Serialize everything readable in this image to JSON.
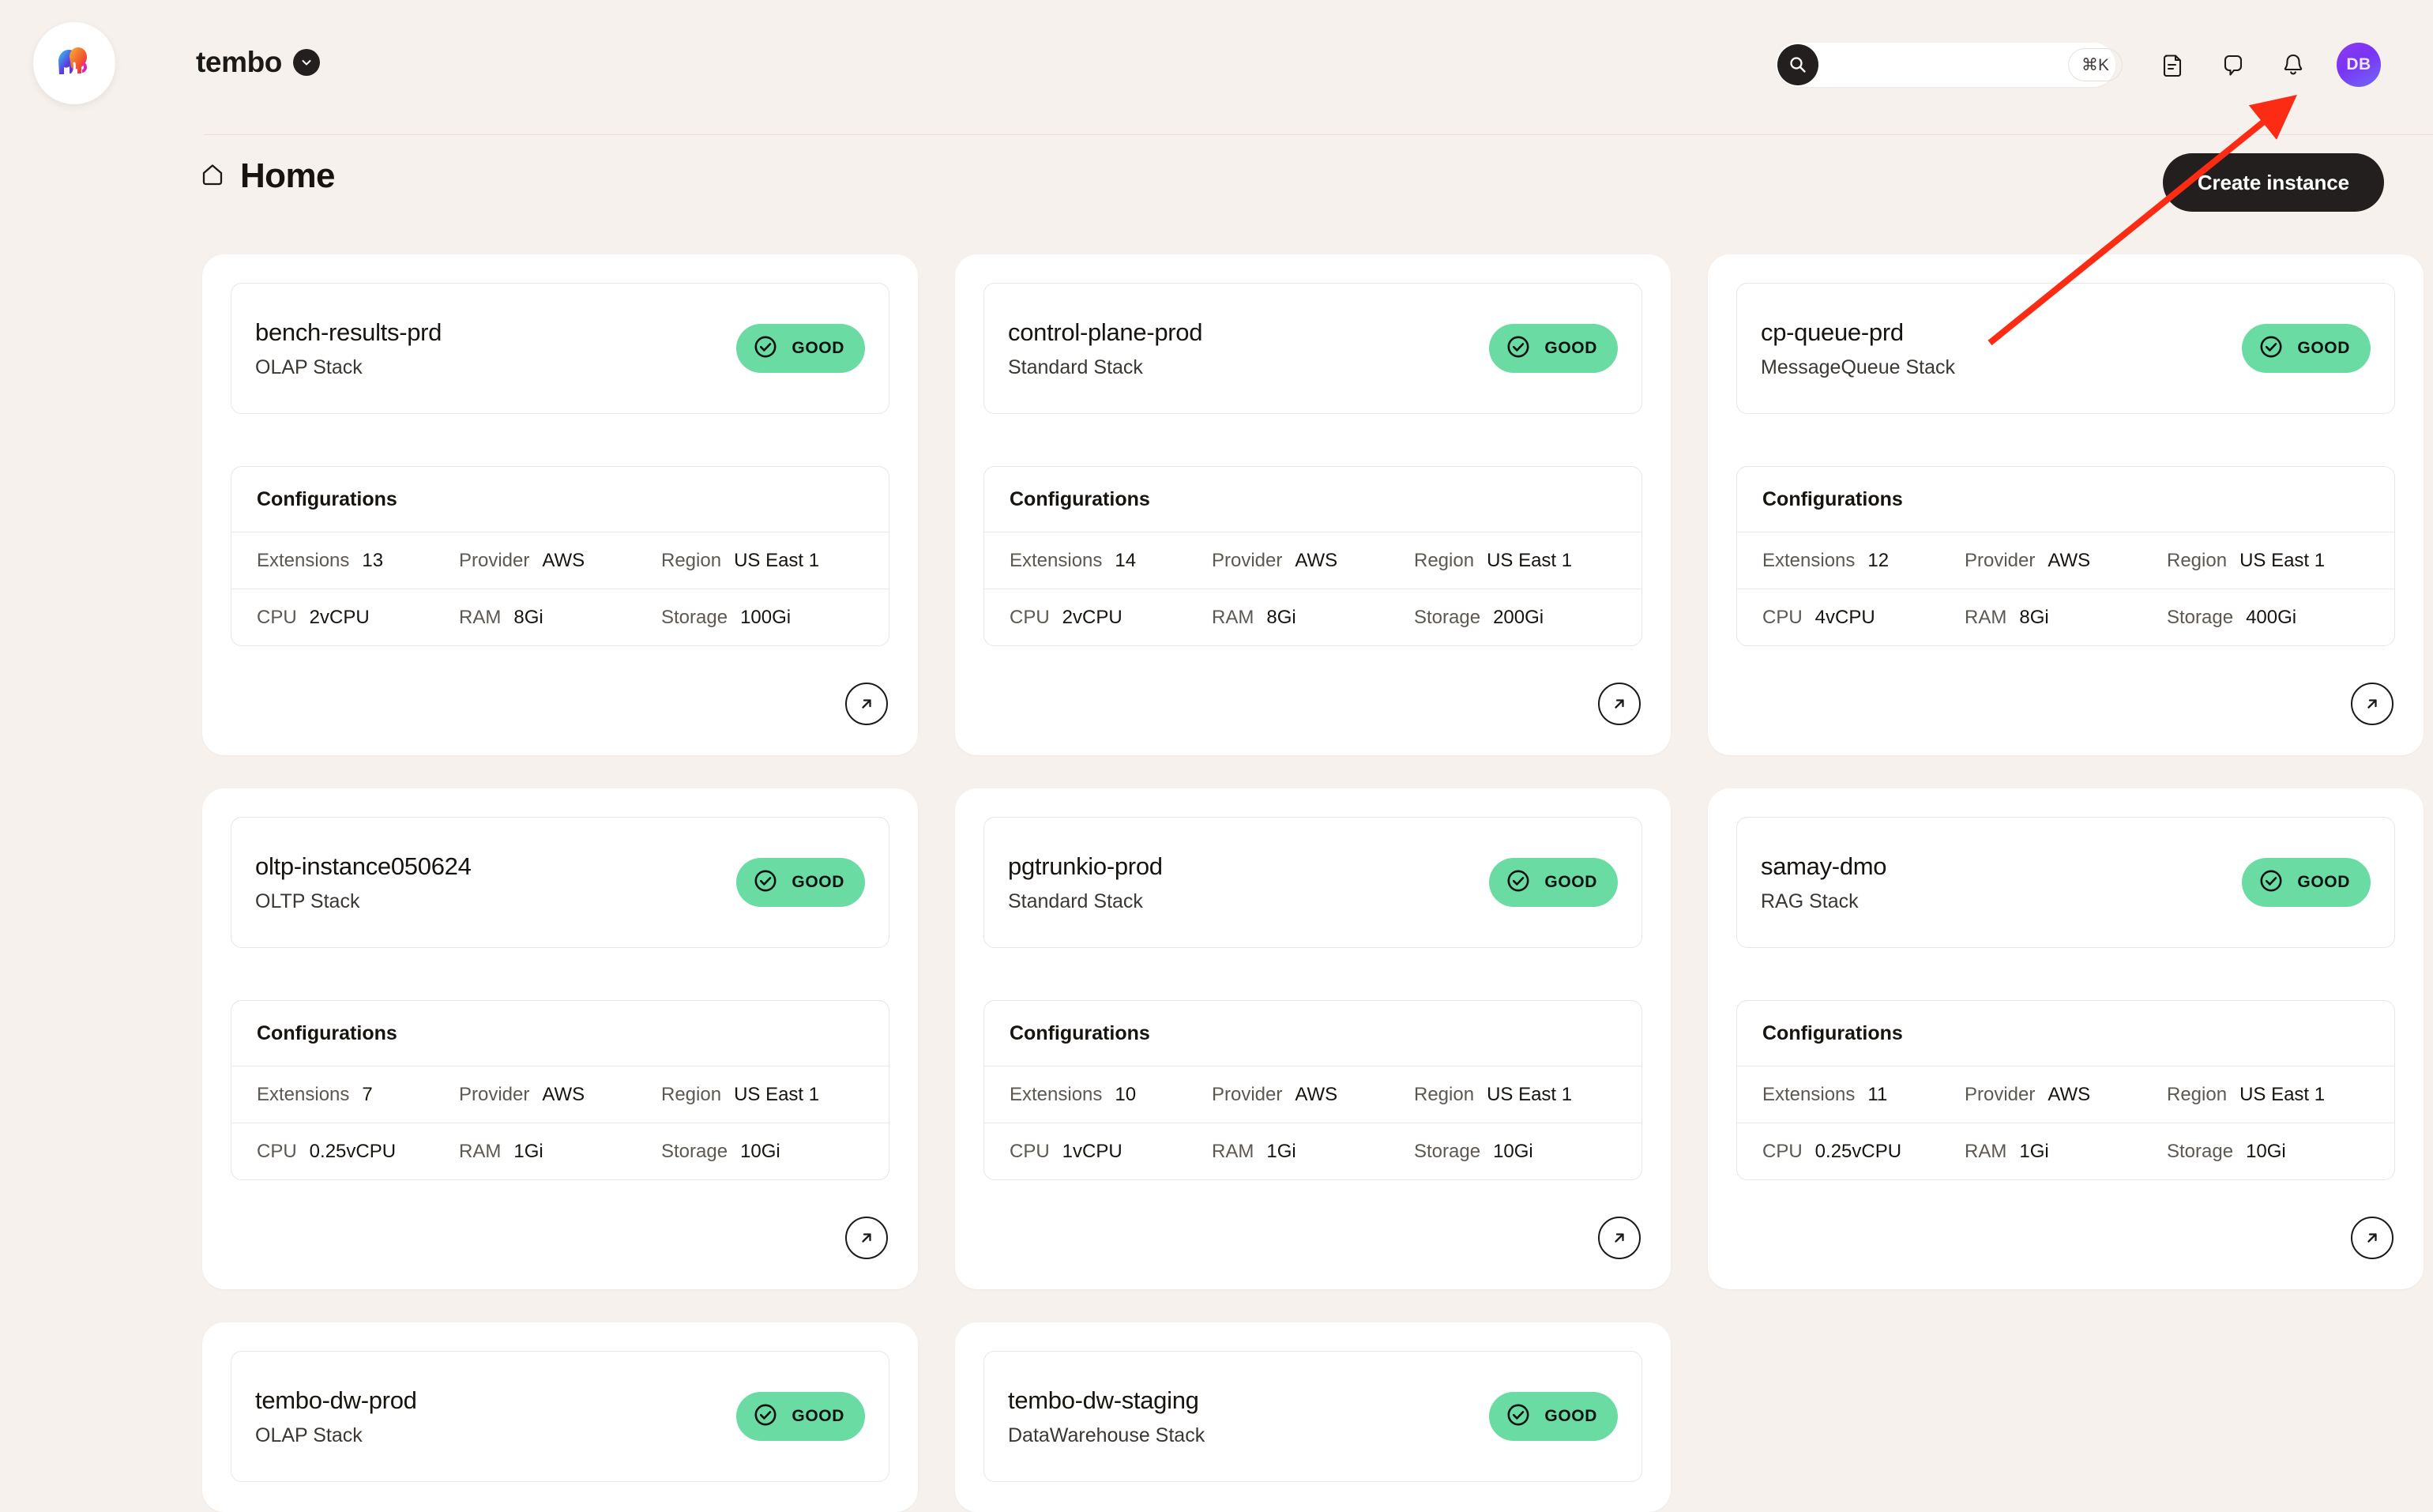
{
  "header": {
    "logo_icon": "tembo-elephant-logo",
    "org_name": "tembo",
    "org_chevron_icon": "chevron-down-icon",
    "search": {
      "icon": "search-icon",
      "value": "",
      "placeholder": "",
      "shortcut": "⌘K"
    },
    "icons": [
      {
        "name": "docs-icon"
      },
      {
        "name": "chat-bubble-icon"
      },
      {
        "name": "bell-icon"
      }
    ],
    "avatar": {
      "initials": "DB",
      "color": "#7A34F5"
    }
  },
  "page": {
    "home_icon": "home-icon",
    "title": "Home",
    "create_button": "Create instance"
  },
  "config_labels": {
    "panel_title": "Configurations",
    "extensions": "Extensions",
    "provider": "Provider",
    "region": "Region",
    "cpu": "CPU",
    "ram": "RAM",
    "storage": "Storage"
  },
  "status": {
    "label": "GOOD",
    "icon": "check-circle-icon",
    "color": "#6ADCA3"
  },
  "open_icon": "arrow-up-right-circle-icon",
  "instances": [
    {
      "name": "bench-results-prd",
      "stack": "OLAP Stack",
      "status": "GOOD",
      "extensions": "13",
      "provider": "AWS",
      "region": "US East 1",
      "cpu": "2vCPU",
      "ram": "8Gi",
      "storage": "100Gi",
      "partial": false
    },
    {
      "name": "control-plane-prod",
      "stack": "Standard Stack",
      "status": "GOOD",
      "extensions": "14",
      "provider": "AWS",
      "region": "US East 1",
      "cpu": "2vCPU",
      "ram": "8Gi",
      "storage": "200Gi",
      "partial": false
    },
    {
      "name": "cp-queue-prd",
      "stack": "MessageQueue Stack",
      "status": "GOOD",
      "extensions": "12",
      "provider": "AWS",
      "region": "US East 1",
      "cpu": "4vCPU",
      "ram": "8Gi",
      "storage": "400Gi",
      "partial": false
    },
    {
      "name": "oltp-instance050624",
      "stack": "OLTP Stack",
      "status": "GOOD",
      "extensions": "7",
      "provider": "AWS",
      "region": "US East 1",
      "cpu": "0.25vCPU",
      "ram": "1Gi",
      "storage": "10Gi",
      "partial": false
    },
    {
      "name": "pgtrunkio-prod",
      "stack": "Standard Stack",
      "status": "GOOD",
      "extensions": "10",
      "provider": "AWS",
      "region": "US East 1",
      "cpu": "1vCPU",
      "ram": "1Gi",
      "storage": "10Gi",
      "partial": false
    },
    {
      "name": "samay-dmo",
      "stack": "RAG Stack",
      "status": "GOOD",
      "extensions": "11",
      "provider": "AWS",
      "region": "US East 1",
      "cpu": "0.25vCPU",
      "ram": "1Gi",
      "storage": "10Gi",
      "partial": false
    },
    {
      "name": "tembo-dw-prod",
      "stack": "OLAP Stack",
      "status": "GOOD",
      "partial": true
    },
    {
      "name": "tembo-dw-staging",
      "stack": "DataWarehouse Stack",
      "status": "GOOD",
      "partial": true
    }
  ],
  "annotation": {
    "type": "arrow",
    "color": "#FB2B14",
    "points_to": "bell-icon"
  }
}
